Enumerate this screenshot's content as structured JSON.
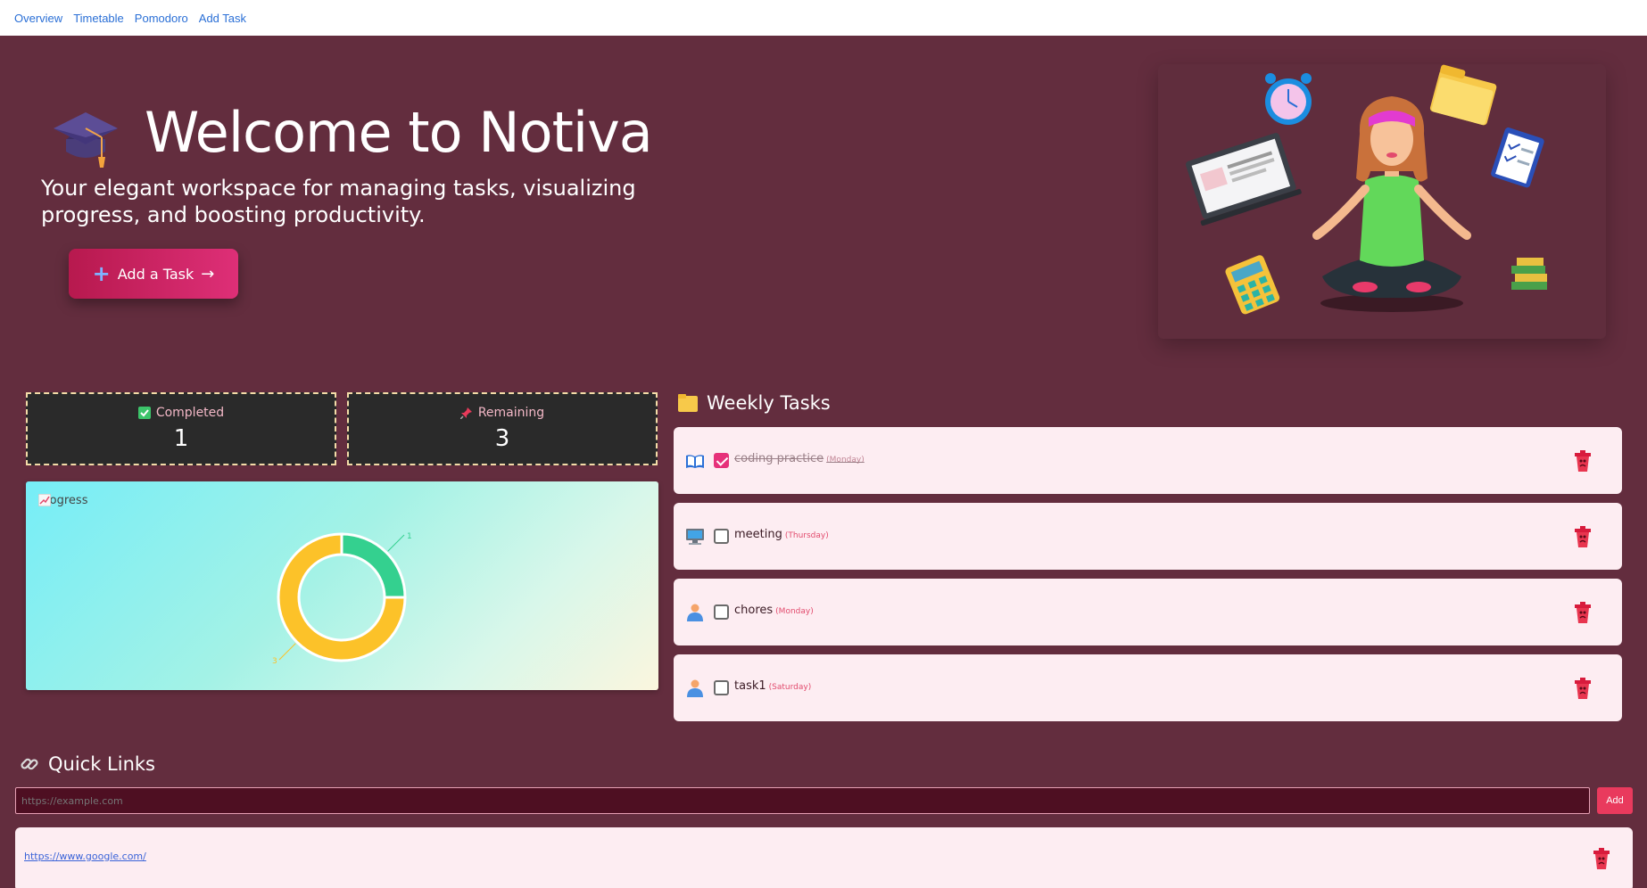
{
  "nav": {
    "items": [
      "Overview",
      "Timetable",
      "Pomodoro",
      "Add Task"
    ]
  },
  "hero": {
    "title": "Welcome to Notiva",
    "subtitle": "Your elegant workspace for managing tasks, visualizing progress, and boosting productivity.",
    "add_button_label": "Add a Task",
    "icon": "graduation-cap-icon"
  },
  "stats": {
    "completed_label": "Completed",
    "completed_value": "1",
    "remaining_label": "Remaining",
    "remaining_value": "3"
  },
  "progress": {
    "title": "Progress"
  },
  "chart_data": {
    "type": "pie",
    "donut": true,
    "slices": [
      {
        "value": 1,
        "color": "#34d08f"
      },
      {
        "value": 3,
        "color": "#fcc229"
      }
    ],
    "data_labels": [
      "1",
      "3"
    ]
  },
  "weekly": {
    "title": "Weekly Tasks",
    "tasks": [
      {
        "name": "coding practice",
        "day": "(Monday)",
        "done": true,
        "icon": "book-icon"
      },
      {
        "name": "meeting",
        "day": "(Thursday)",
        "done": false,
        "icon": "computer-icon"
      },
      {
        "name": "chores",
        "day": "(Monday)",
        "done": false,
        "icon": "person-icon"
      },
      {
        "name": "task1",
        "day": "(Saturday)",
        "done": false,
        "icon": "person-icon"
      }
    ]
  },
  "quick_links": {
    "title": "Quick Links",
    "input_placeholder": "https://example.com",
    "add_label": "Add",
    "links": [
      "https://www.google.com/"
    ]
  },
  "colors": {
    "background": "#632d3e",
    "accent": "#de2f77",
    "card": "#fdedf2",
    "stat_bg": "#2a2a2a"
  }
}
